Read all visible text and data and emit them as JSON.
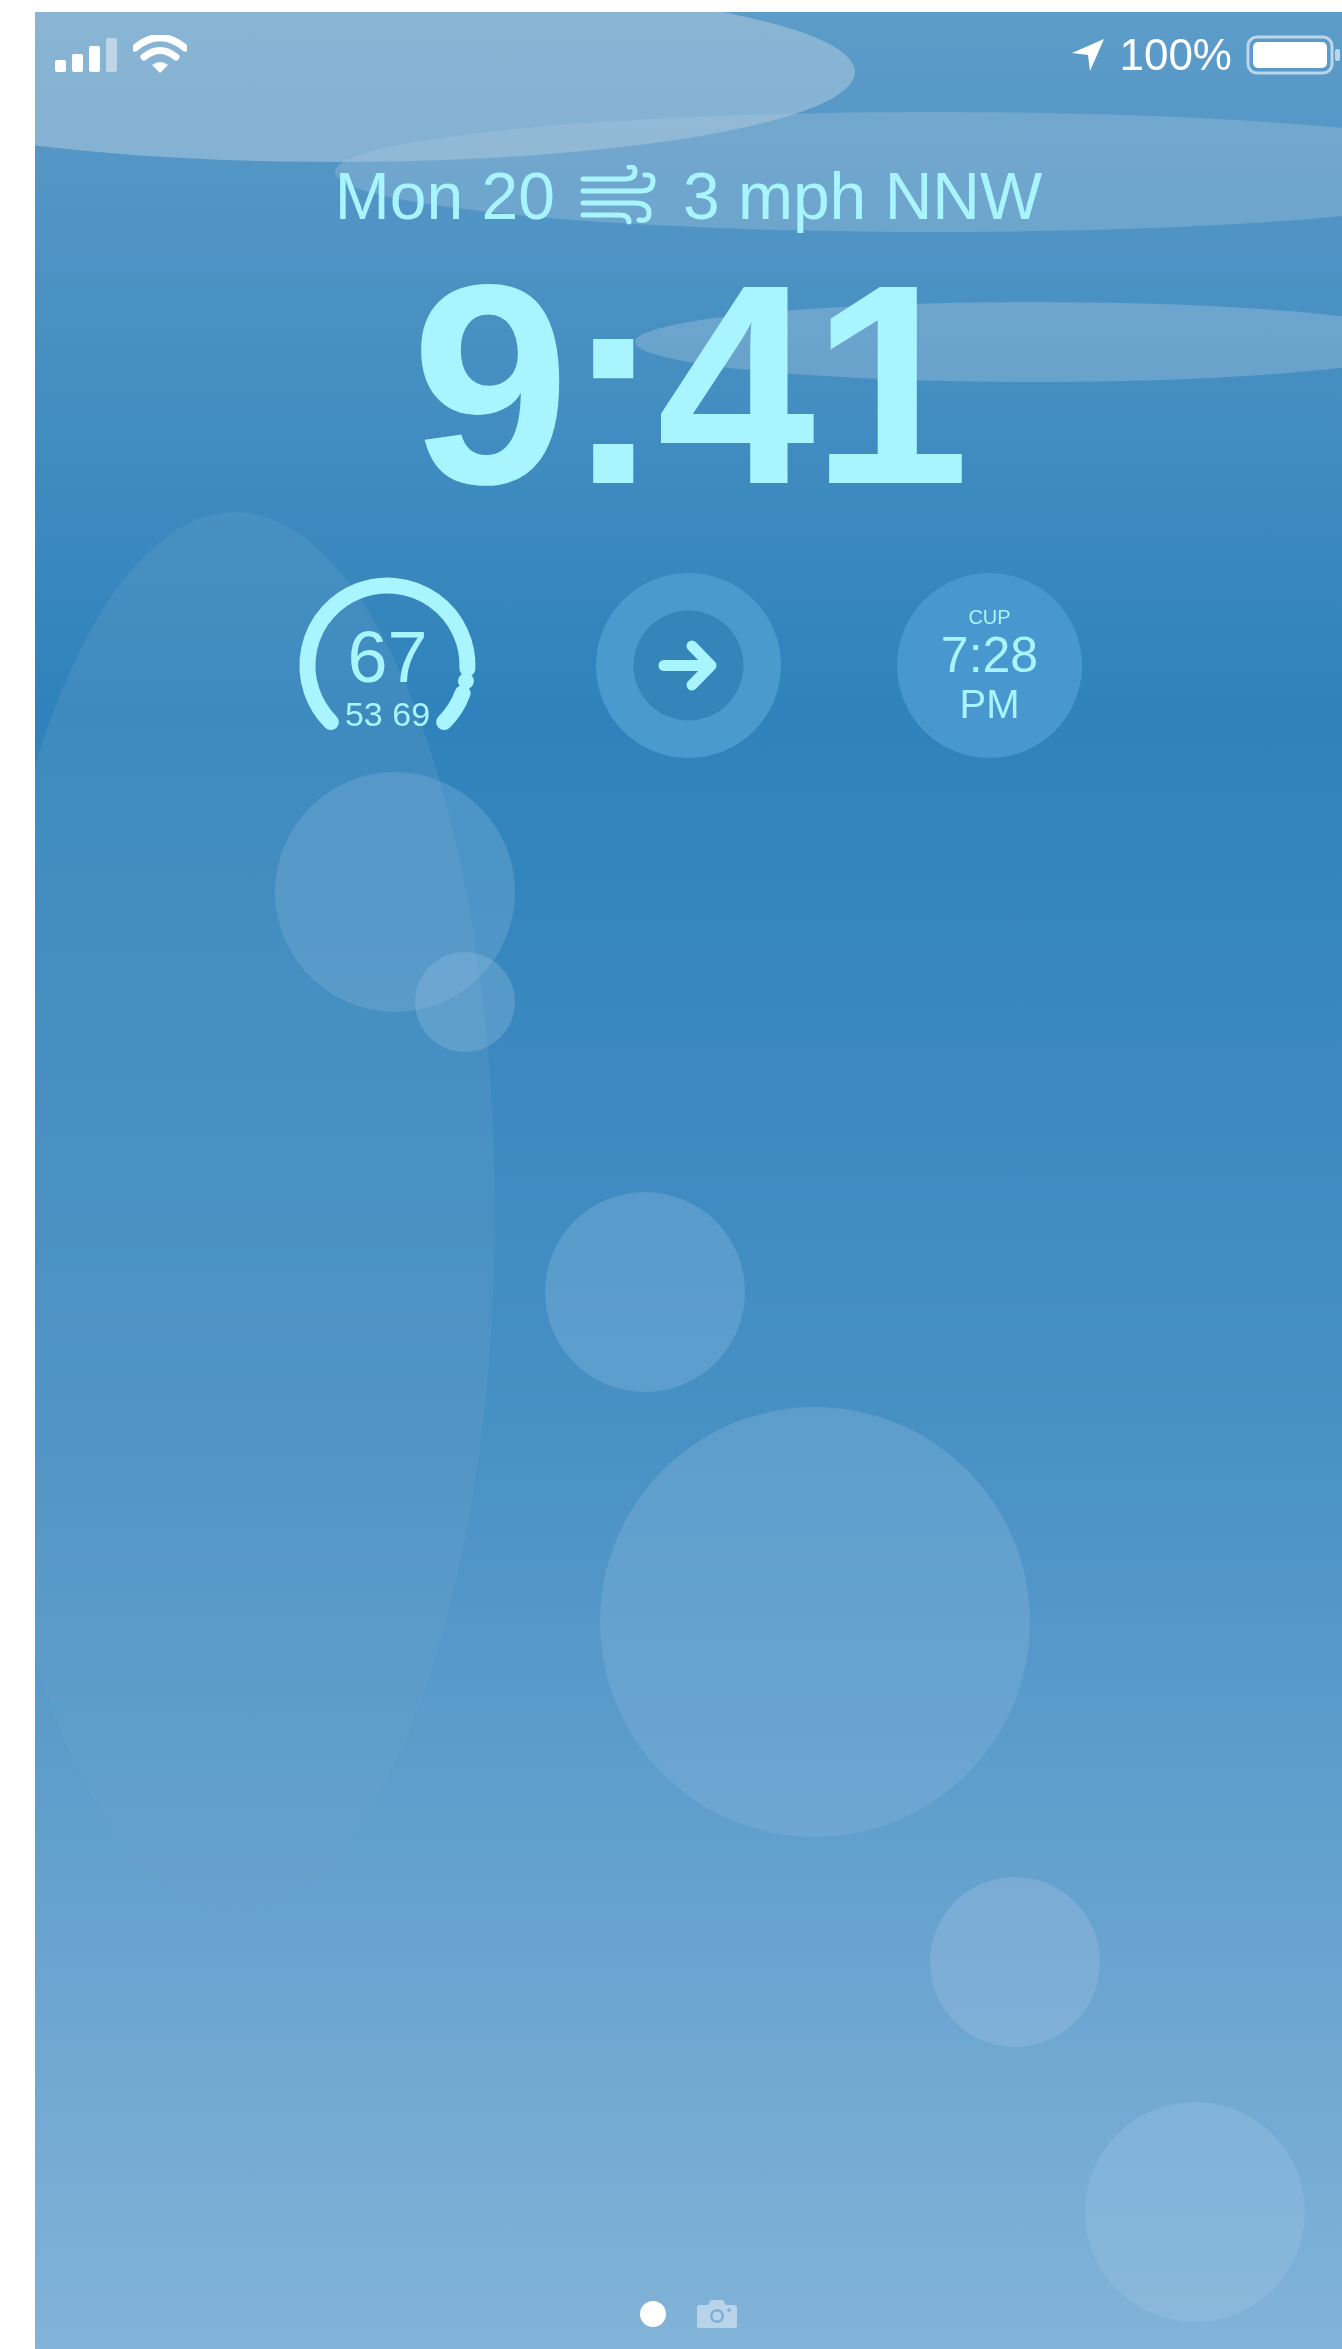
{
  "status_bar": {
    "battery_text": "100%"
  },
  "date_line": {
    "date": "Mon 20",
    "wind": "3 mph NNW"
  },
  "time": "9:41",
  "widgets": [
    {
      "kind": "gauge",
      "value": "67",
      "low": "53",
      "high": "69",
      "level": 0.875
    },
    {
      "kind": "shortcut"
    },
    {
      "kind": "clock",
      "label": "CUP",
      "time": "7:28",
      "period": "PM"
    }
  ],
  "page_indicator": [
    {
      "kind": "dot",
      "selected": true
    },
    {
      "kind": "camera",
      "selected": false
    }
  ]
}
